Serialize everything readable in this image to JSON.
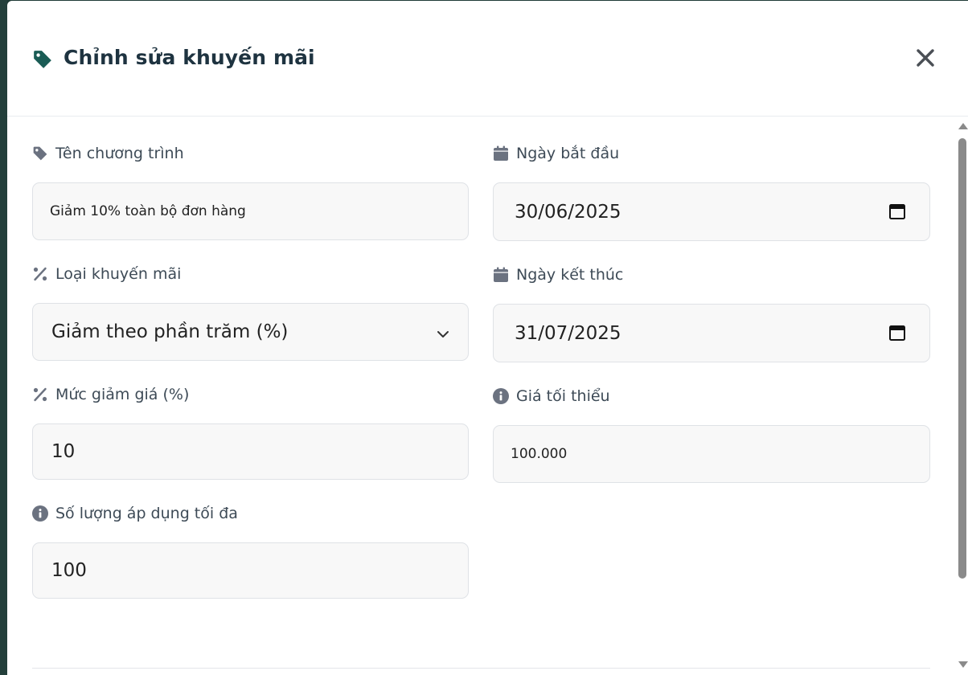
{
  "modal": {
    "title": "Chỉnh sửa khuyến mãi",
    "title_icon": "tag-icon",
    "close_icon": "close-icon",
    "accent_color": "#1a5c55"
  },
  "form": {
    "name": {
      "label": "Tên chương trình",
      "icon": "tag-icon",
      "value": "Giảm 10% toàn bộ đơn hàng"
    },
    "start_date": {
      "label": "Ngày bắt đầu",
      "icon": "calendar-icon",
      "value": "30/06/2025"
    },
    "type": {
      "label": "Loại khuyến mãi",
      "icon": "percent-icon",
      "value": "Giảm theo phần trăm (%)"
    },
    "end_date": {
      "label": "Ngày kết thúc",
      "icon": "calendar-icon",
      "value": "31/07/2025"
    },
    "discount": {
      "label": "Mức giảm giá (%)",
      "icon": "percent-icon",
      "value": "10"
    },
    "min_price": {
      "label": "Giá tối thiểu",
      "icon": "info-icon",
      "value": "100.000"
    },
    "max_usage": {
      "label": "Số lượng áp dụng tối đa",
      "icon": "info-icon",
      "value": "100"
    }
  },
  "colors": {
    "label_icon": "#6b7280",
    "input_bg": "#f8f8f8",
    "title_text": "#1e3340"
  }
}
